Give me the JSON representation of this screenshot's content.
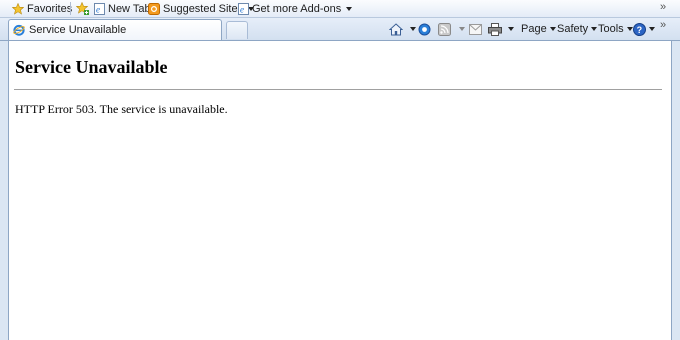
{
  "favorites_bar": {
    "favorites_label": "Favorites",
    "new_tab_label": "New Tab",
    "suggested_sites_label": "Suggested Sites",
    "addons_label": "Get more Add-ons",
    "overflow_glyph": "»"
  },
  "tab": {
    "title": "Service Unavailable"
  },
  "command_bar": {
    "page_label": "Page",
    "safety_label": "Safety",
    "tools_label": "Tools",
    "overflow_glyph": "»"
  },
  "page": {
    "heading": "Service Unavailable",
    "message": "HTTP Error 503. The service is unavailable."
  },
  "icons": [
    "star-icon",
    "add-favorite-icon",
    "ie-page-icon",
    "suggested-sites-icon",
    "home-icon",
    "feeds-icon",
    "rss-icon",
    "mail-icon",
    "print-icon",
    "help-icon"
  ],
  "colors": {
    "chrome": "#dbe6f3",
    "border": "#8ea6c4",
    "page_bg": "#ffffff"
  }
}
